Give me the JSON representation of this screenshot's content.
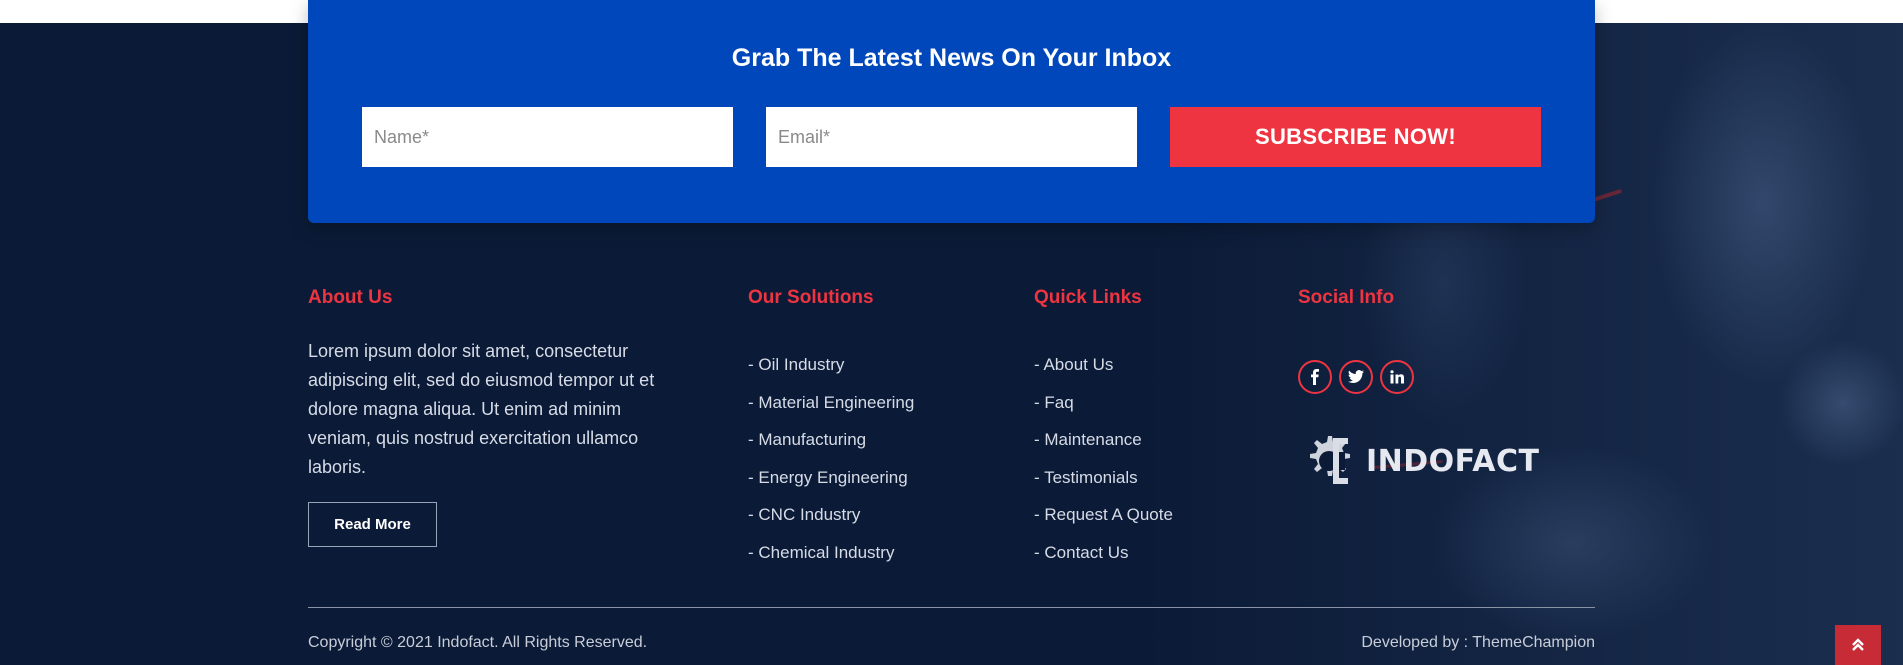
{
  "newsletter": {
    "title": "Grab The Latest News On Your Inbox",
    "name_placeholder": "Name*",
    "email_placeholder": "Email*",
    "submit_label": "SUBSCRIBE NOW!"
  },
  "about": {
    "heading": "About Us",
    "text": "Lorem ipsum dolor sit amet, consectetur adipiscing elit, sed do eiusmod tempor ut et dolore magna aliqua. Ut enim ad minim veniam, quis nostrud exercitation ullamco laboris.",
    "read_more_label": "Read More"
  },
  "solutions": {
    "heading": "Our Solutions",
    "items": [
      "Oil Industry",
      "Material Engineering",
      "Manufacturing",
      "Energy Engineering",
      "CNC Industry",
      "Chemical Industry"
    ]
  },
  "quick_links": {
    "heading": "Quick Links",
    "items": [
      "About Us",
      "Faq",
      "Maintenance",
      "Testimonials",
      "Request A Quote",
      "Contact Us"
    ]
  },
  "social": {
    "heading": "Social Info",
    "icons": [
      "facebook-icon",
      "twitter-icon",
      "linkedin-icon"
    ],
    "logo_text": "INDOFACT"
  },
  "bottom_bar": {
    "copyright": "Copyright © 2021 Indofact. All Rights Reserved.",
    "developed_by": "Developed by : ThemeChampion"
  },
  "colors": {
    "footer_bg": "#0b1b37",
    "newsletter_bg": "#0047bb",
    "accent_red": "#ee3440"
  }
}
